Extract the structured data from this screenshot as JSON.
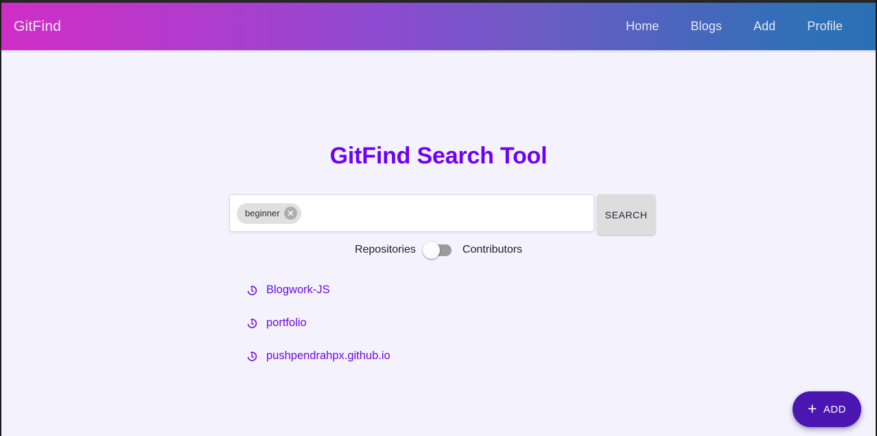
{
  "theme": {
    "page_bg": "#f4f3fd",
    "nav_gradient_start": "#cf2ec6",
    "nav_gradient_end": "#2a6fb4",
    "title_color": "#7000f5",
    "link_color": "#6d0ae3",
    "fab_color": "#4a15b0",
    "chip_bg": "#e0e0e0",
    "search_button_bg": "#dddddd",
    "switch_track": "#9b9b9b"
  },
  "navbar": {
    "brand": "GitFind",
    "links": [
      {
        "label": "Home",
        "name": "nav-link-home"
      },
      {
        "label": "Blogs",
        "name": "nav-link-blogs"
      },
      {
        "label": "Add",
        "name": "nav-link-add"
      },
      {
        "label": "Profile",
        "name": "nav-link-profile"
      }
    ]
  },
  "main": {
    "title": "GitFind Search Tool",
    "search": {
      "placeholder": "",
      "value": "",
      "chips": [
        {
          "label": "beginner",
          "remove_icon": "close-circle-icon"
        }
      ],
      "button_label": "SEARCH"
    },
    "mode_toggle": {
      "left_label": "Repositories",
      "right_label": "Contributors",
      "state": "off",
      "selected": "Repositories"
    },
    "results": [
      {
        "label": "Blogwork-JS",
        "icon": "history-icon"
      },
      {
        "label": "portfolio",
        "icon": "history-icon"
      },
      {
        "label": "pushpendrahpx.github.io",
        "icon": "history-icon"
      }
    ]
  },
  "fab": {
    "icon": "plus-icon",
    "label": "ADD"
  }
}
